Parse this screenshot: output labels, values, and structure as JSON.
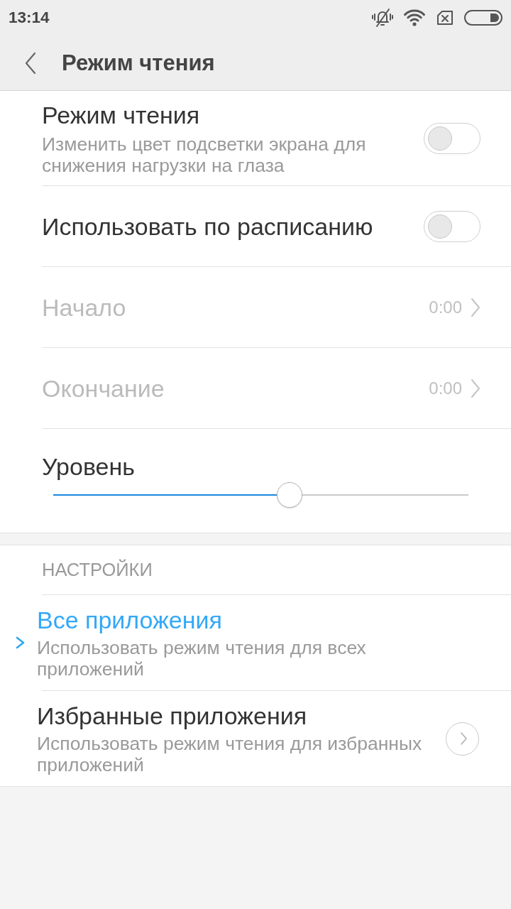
{
  "status_bar": {
    "time": "13:14"
  },
  "app_bar": {
    "title": "Режим чтения"
  },
  "settings": [
    {
      "kind": "toggle",
      "title": "Режим чтения",
      "subtitle": "Изменить цвет подсветки экрана для снижения нагрузки на глаза",
      "on": false,
      "disabled": false
    },
    {
      "kind": "toggle",
      "title": "Использовать по расписанию",
      "on": false,
      "disabled": false
    },
    {
      "kind": "value",
      "title": "Начало",
      "value": "0:00",
      "disabled": true
    },
    {
      "kind": "value",
      "title": "Окончание",
      "value": "0:00",
      "disabled": true
    },
    {
      "kind": "slider",
      "title": "Уровень",
      "level": 0.57,
      "disabled": false
    }
  ],
  "apps_section": {
    "header": "НАСТРОЙКИ",
    "options": [
      {
        "kind": "plain",
        "title": "Все приложения",
        "subtitle": "Использовать режим чтения для всех приложений",
        "selected": true
      },
      {
        "kind": "picker",
        "title": "Избранные приложения",
        "subtitle": "Использовать режим чтения для избранных приложений",
        "selected": false
      }
    ]
  }
}
